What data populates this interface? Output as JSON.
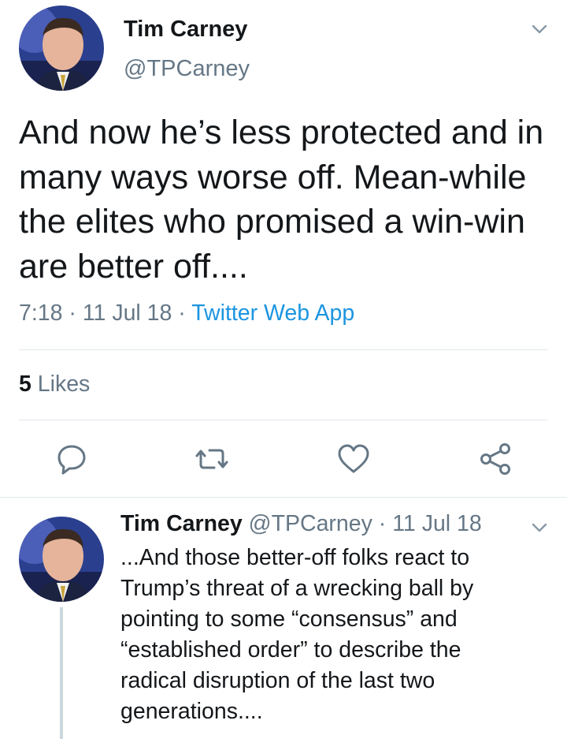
{
  "tweet": {
    "author_name": "Tim Carney",
    "author_handle": "@TPCarney",
    "text": "And now he’s less protected and in many ways worse off. Mean-while the elites who promised a win-win are better off....",
    "time": "7:18",
    "date": "11 Jul 18",
    "separator": " · ",
    "source": "Twitter Web App",
    "likes_count": "5",
    "likes_label": " Likes"
  },
  "reply": {
    "author_name": "Tim Carney",
    "author_handle": "@TPCarney",
    "date": " · 11 Jul 18",
    "text_lines": [
      "...And those better-off folks react to",
      "Trump’s threat of a wrecking ball by",
      "pointing to some “consensus” and",
      "“established order” to describe the",
      "radical disruption of the last two",
      "generations...."
    ]
  },
  "icons": [
    "chevron-down-icon",
    "reply-icon",
    "retweet-icon",
    "like-icon",
    "share-icon"
  ],
  "colors": {
    "text": "#14171a",
    "secondary": "#657786",
    "link": "#1b95e0",
    "divider": "#e1e8ed",
    "icon": "#657786"
  }
}
